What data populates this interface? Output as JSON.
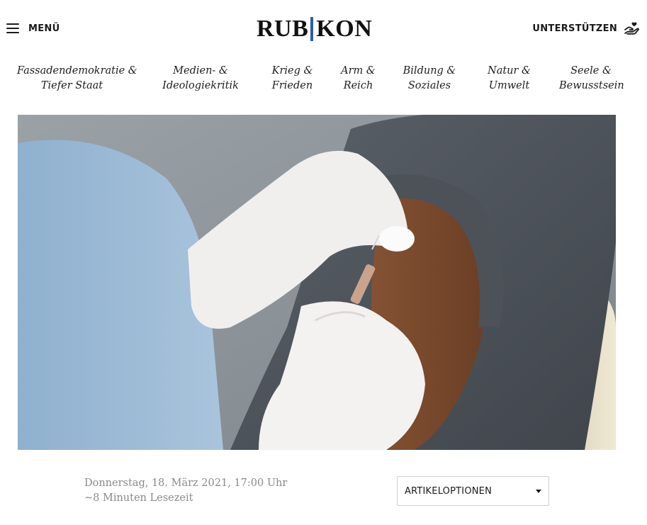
{
  "header": {
    "menu_label": "MENÜ",
    "logo": {
      "left": "RUB",
      "right": "KON",
      "accent_color": "#2b5ea8"
    },
    "support_label": "UNTERSTÜTZEN",
    "support_icon": "hand-with-heart-icon",
    "menu_icon": "hamburger-icon"
  },
  "categories": [
    {
      "line1": "Fassadendemokratie &",
      "line2": "Tiefer Staat"
    },
    {
      "line1": "Medien- &",
      "line2": "Ideologiekritik"
    },
    {
      "line1": "Krieg &",
      "line2": "Frieden"
    },
    {
      "line1": "Arm &",
      "line2": "Reich"
    },
    {
      "line1": "Bildung &",
      "line2": "Soziales"
    },
    {
      "line1": "Natur &",
      "line2": "Umwelt"
    },
    {
      "line1": "Seele &",
      "line2": "Bewusstsein"
    }
  ],
  "hero": {
    "image": "vaccination-photo"
  },
  "article_meta": {
    "date": "Donnerstag, 18. März 2021, 17:00 Uhr",
    "reading_time": "~8 Minuten Lesezeit"
  },
  "article_options": {
    "label": "ARTIKELOPTIONEN",
    "icon": "caret-down-icon"
  }
}
